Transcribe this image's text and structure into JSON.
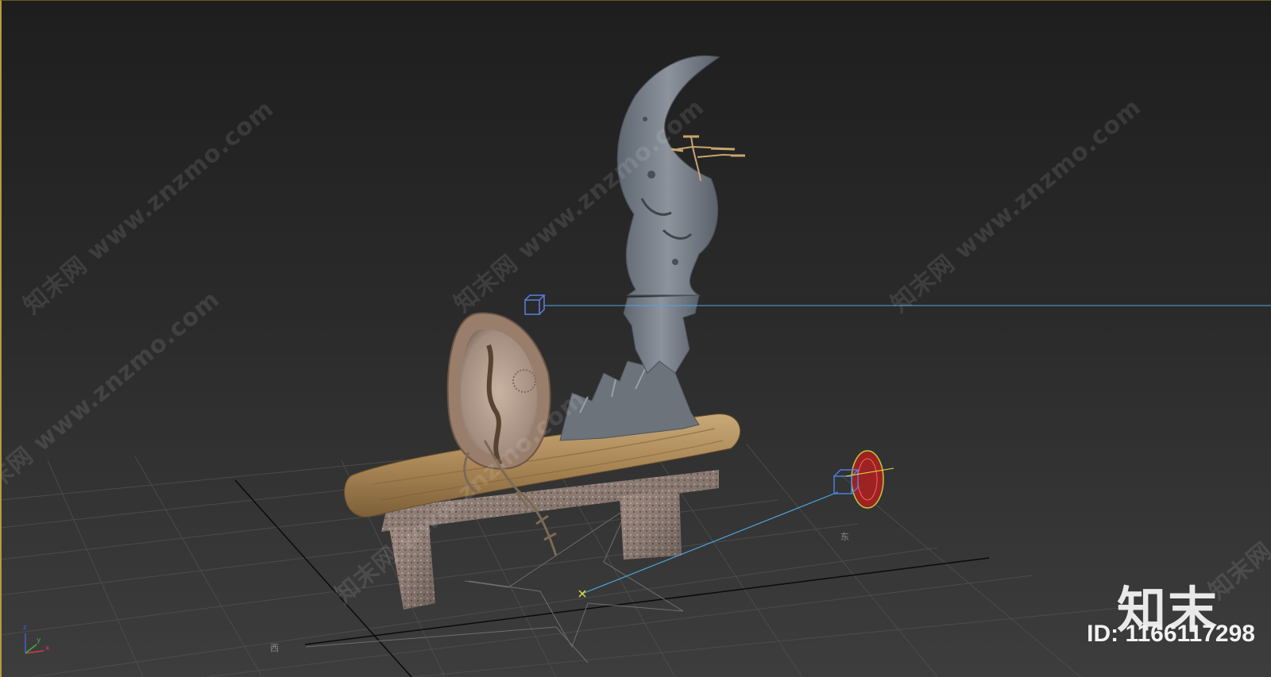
{
  "viewport": {
    "background_top": "#1e1e1e",
    "background_bottom": "#3d3d3d",
    "active_border_color": "#b89a3a",
    "grid_color": "#505050",
    "grid_major_color": "#0a0a0a"
  },
  "watermarks": [
    {
      "text": "知末网 www.znzmo.com"
    },
    {
      "text": "知末网 www.znzmo.com"
    },
    {
      "text": "知末网 www.znzmo.com"
    },
    {
      "text": "知末网 www.znzmo.com"
    },
    {
      "text": "知末网 www.znzmo.com"
    },
    {
      "text": "知末网"
    }
  ],
  "brand": {
    "logo_text": "知末",
    "id_text": "ID: 1166117298"
  },
  "compass": {
    "east_label": "东",
    "west_label": "西"
  },
  "axis_gizmo": {
    "x_label": "x",
    "y_label": "y",
    "z_label": "z",
    "x_color": "#d04040",
    "y_color": "#40b040",
    "z_color": "#4060d0"
  },
  "objects": {
    "scholar_rock": "grey-stone-sculpture",
    "driftwood_bench": "wooden-plank-on-granite-legs",
    "agate_slice": "oval-stone-plaque",
    "bonsai": "small-pine-bonsai",
    "camera": "target-camera-gizmo",
    "light": "target-light-gizmo",
    "selection_line_color": "#4aa8e0"
  }
}
